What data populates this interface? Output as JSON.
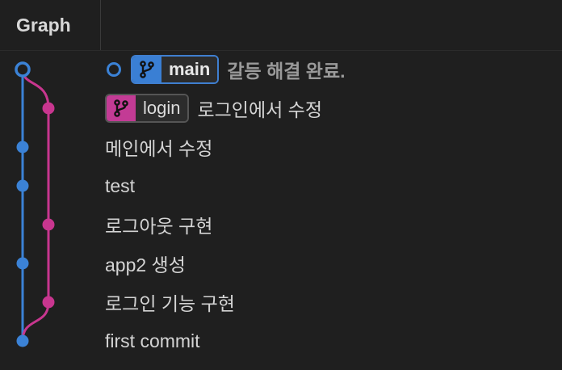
{
  "header": {
    "graph_label": "Graph"
  },
  "colors": {
    "main_lane": "#3b82d6",
    "login_lane": "#c8368f",
    "background": "#1f1f1f"
  },
  "commits": [
    {
      "message": "갈등 해결 완료.",
      "branch": "main",
      "lane": "main",
      "head": true
    },
    {
      "message": "로그인에서 수정",
      "branch": "login",
      "lane": "login"
    },
    {
      "message": "메인에서 수정",
      "lane": "main"
    },
    {
      "message": "test",
      "lane": "main"
    },
    {
      "message": "로그아웃 구현",
      "lane": "login"
    },
    {
      "message": "app2 생성",
      "lane": "main"
    },
    {
      "message": "로그인 기능 구현",
      "lane": "login"
    },
    {
      "message": "first commit",
      "lane": "main"
    }
  ],
  "icons": {
    "branch": "git-branch-icon",
    "head": "head-ring-icon"
  }
}
